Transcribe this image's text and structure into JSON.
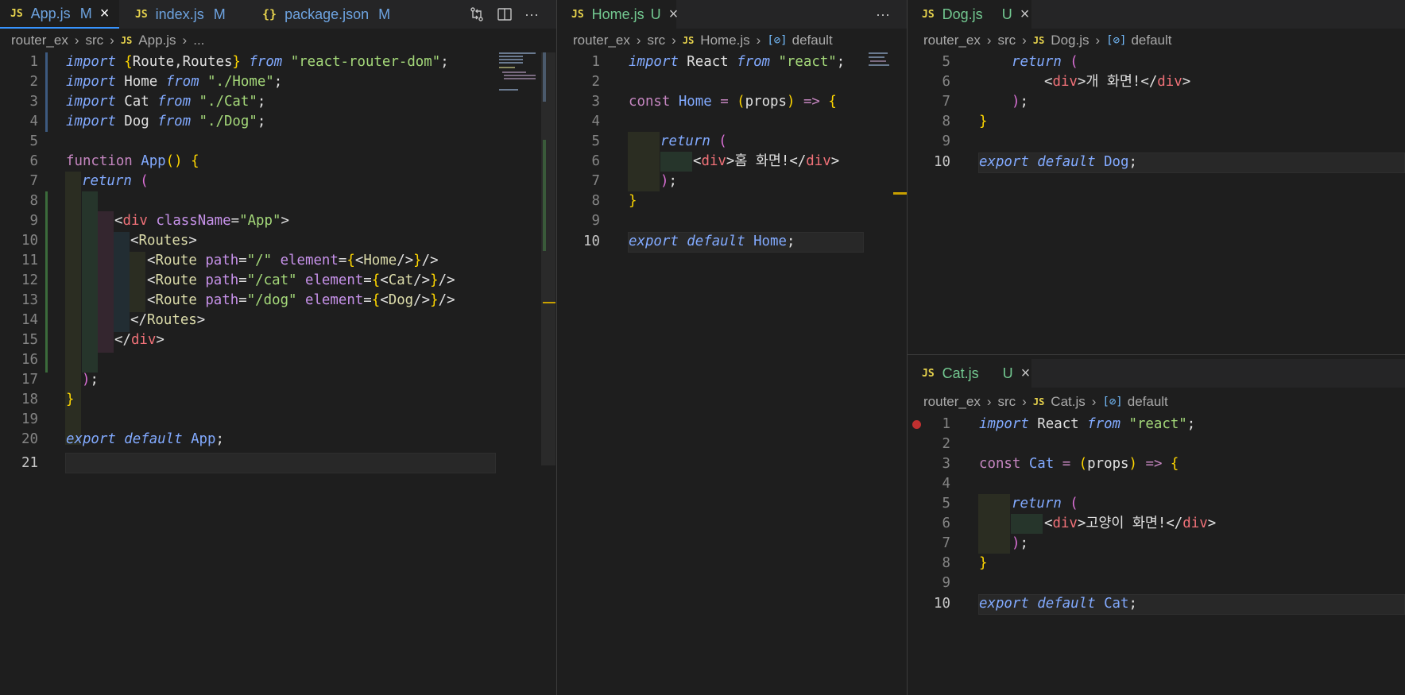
{
  "left_editor": {
    "tabs": [
      {
        "label": "App.js",
        "badge": "M",
        "close": "×"
      },
      {
        "label": "index.js",
        "badge": "M"
      },
      {
        "label": "package.json",
        "badge": "M"
      }
    ],
    "breadcrumb": [
      "router_ex",
      "src",
      "App.js",
      "..."
    ],
    "lines": [
      {
        "n": "1"
      },
      {
        "n": "2"
      },
      {
        "n": "3"
      },
      {
        "n": "4"
      },
      {
        "n": "5"
      },
      {
        "n": "6"
      },
      {
        "n": "7"
      },
      {
        "n": "8"
      },
      {
        "n": "9"
      },
      {
        "n": "10"
      },
      {
        "n": "11"
      },
      {
        "n": "12"
      },
      {
        "n": "13"
      },
      {
        "n": "14"
      },
      {
        "n": "15"
      },
      {
        "n": "16"
      },
      {
        "n": "17"
      },
      {
        "n": "18"
      },
      {
        "n": "19"
      },
      {
        "n": "20"
      },
      {
        "n": "21"
      }
    ]
  },
  "middle_editor": {
    "tab": {
      "label": "Home.js",
      "badge": "U",
      "close": "×"
    },
    "breadcrumb": [
      "router_ex",
      "src",
      "Home.js",
      "default"
    ],
    "line_numbers": [
      "1",
      "2",
      "3",
      "4",
      "5",
      "6",
      "7",
      "8",
      "9",
      "10"
    ]
  },
  "right_top_editor": {
    "tab": {
      "label": "Dog.js",
      "badge": "U",
      "close": "×"
    },
    "breadcrumb": [
      "router_ex",
      "src",
      "Dog.js",
      "default"
    ],
    "line_numbers": [
      "5",
      "6",
      "7",
      "8",
      "9",
      "10"
    ]
  },
  "right_bottom_editor": {
    "tab": {
      "label": "Cat.js",
      "badge": "U",
      "close": "×"
    },
    "breadcrumb": [
      "router_ex",
      "src",
      "Cat.js",
      "default"
    ],
    "line_numbers": [
      "1",
      "2",
      "3",
      "4",
      "5",
      "6",
      "7",
      "8",
      "9",
      "10"
    ]
  },
  "code": {
    "app": {
      "l1": [
        "import",
        " {",
        "Route,Routes",
        "}",
        " from",
        " \"react-router-dom\"",
        ";"
      ],
      "l2": [
        "import",
        " Home ",
        "from",
        " \"./Home\"",
        ";"
      ],
      "l3": [
        "import",
        " Cat ",
        "from",
        " \"./Cat\"",
        ";"
      ],
      "l4": [
        "import",
        " Dog ",
        "from",
        " \"./Dog\"",
        ";"
      ],
      "l6": [
        "function",
        " App",
        "()",
        " {"
      ],
      "l7": [
        "return",
        " ("
      ],
      "l9": [
        "<",
        "div",
        " className",
        "=",
        "\"App\"",
        ">"
      ],
      "l10": [
        "<",
        "Routes",
        ">"
      ],
      "l11": [
        "<",
        "Route",
        " path",
        "=",
        "\"/\"",
        " element",
        "=",
        "{",
        "<",
        "Home",
        "/>",
        "}",
        "/>"
      ],
      "l12": [
        "<",
        "Route",
        " path",
        "=",
        "\"/cat\"",
        " element",
        "=",
        "{",
        "<",
        "Cat",
        "/>",
        "}",
        "/>"
      ],
      "l13": [
        "<",
        "Route",
        " path",
        "=",
        "\"/dog\"",
        " element",
        "=",
        "{",
        "<",
        "Dog",
        "/>",
        "}",
        "/>"
      ],
      "l14": [
        "</",
        "Routes",
        ">"
      ],
      "l15": [
        "</",
        "div",
        ">"
      ],
      "l17": [
        ")",
        ";"
      ],
      "l18": [
        "}"
      ],
      "l20": [
        "export",
        " default",
        " App",
        ";"
      ]
    },
    "home": {
      "l1": [
        "import",
        " React ",
        "from",
        " \"react\"",
        ";"
      ],
      "l3": [
        "const",
        " Home",
        " =",
        " (",
        "props",
        ")",
        " =>",
        " {"
      ],
      "l5": [
        "return",
        " ("
      ],
      "l6": [
        "<",
        "div",
        ">",
        "홈 화면!",
        "</",
        "div",
        ">"
      ],
      "l7": [
        ")",
        ";"
      ],
      "l8": [
        "}"
      ],
      "l10": [
        "export",
        " default",
        " Home",
        ";"
      ]
    },
    "dog": {
      "l5": [
        "return",
        " ("
      ],
      "l6": [
        "<",
        "div",
        ">",
        "개 화면!",
        "</",
        "div",
        ">"
      ],
      "l7": [
        ")",
        ";"
      ],
      "l8": [
        "}"
      ],
      "l10": [
        "export",
        " default",
        " Dog",
        ";"
      ]
    },
    "cat": {
      "l1": [
        "import",
        " React ",
        "from",
        " \"react\"",
        ";"
      ],
      "l3": [
        "const",
        " Cat",
        " =",
        " (",
        "props",
        ")",
        " =>",
        " {"
      ],
      "l5": [
        "return",
        " ("
      ],
      "l6": [
        "<",
        "div",
        ">",
        "고양이 화면!",
        "</",
        "div",
        ">"
      ],
      "l7": [
        ")",
        ";"
      ],
      "l8": [
        "}"
      ],
      "l10": [
        "export",
        " default",
        " Cat",
        ";"
      ]
    }
  },
  "icons": {
    "compare": "compare-changes-icon",
    "split": "split-editor-icon",
    "more": "more-actions-icon",
    "symbol": "symbol-variable-icon",
    "breakpoint": "breakpoint-icon"
  },
  "colors": {
    "editor_bg": "#1e1e1e",
    "tabbar_bg": "#252526",
    "active_tab_border": "#3794ff",
    "modified": "#6da3e0",
    "untracked": "#73c991",
    "breakpoint": "#c03030"
  }
}
